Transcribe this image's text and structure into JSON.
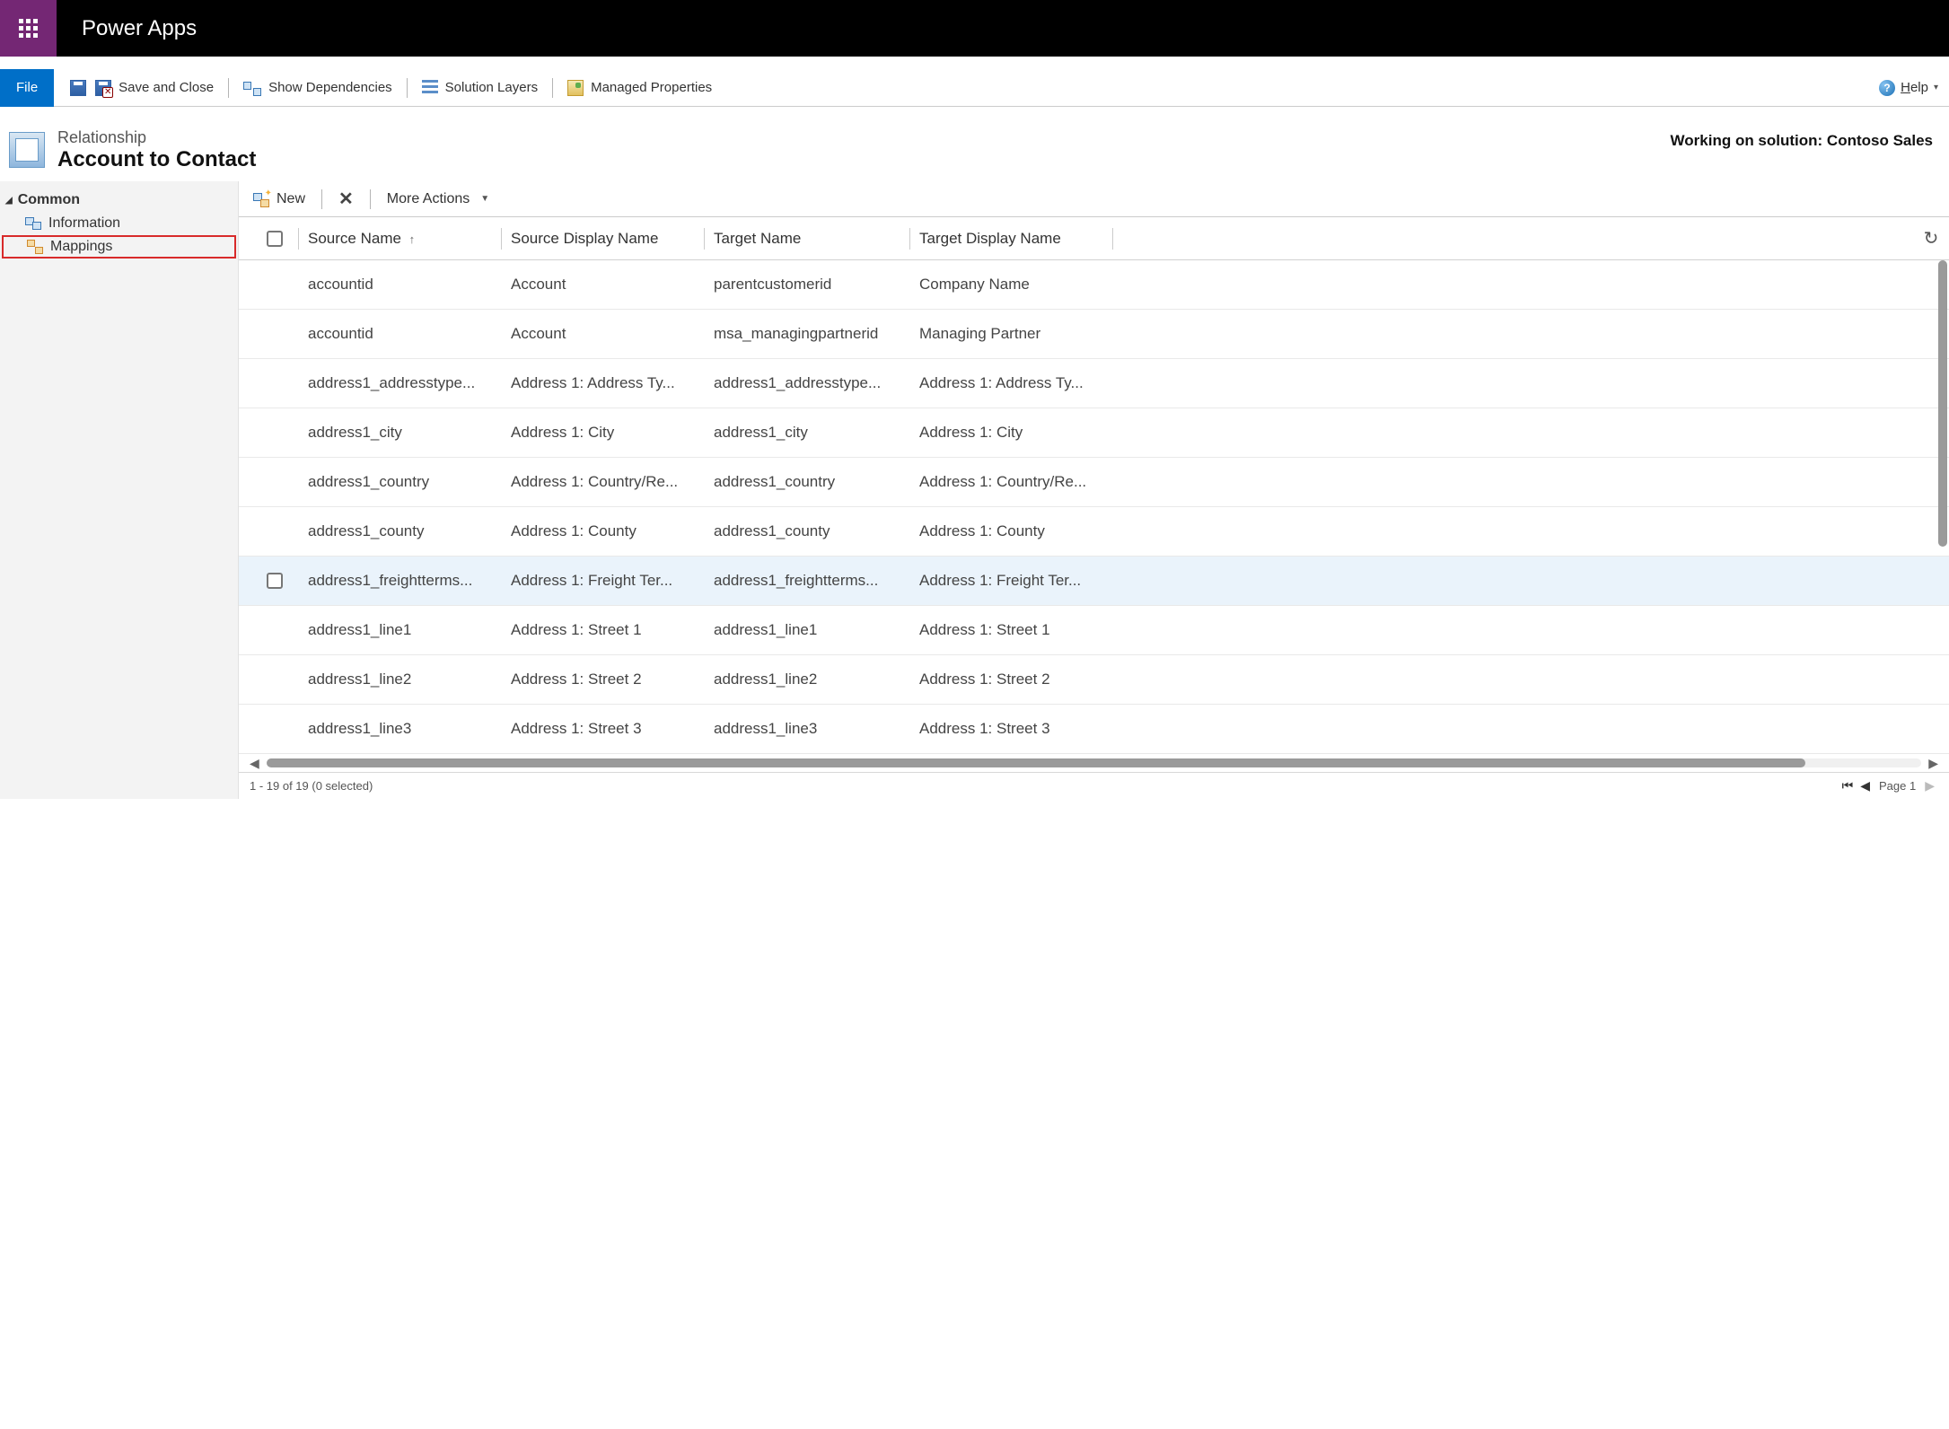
{
  "header": {
    "app_title": "Power Apps"
  },
  "ribbon": {
    "file": "File",
    "save_close": "Save and Close",
    "show_deps": "Show Dependencies",
    "solution_layers": "Solution Layers",
    "managed_props": "Managed Properties",
    "help": "Help"
  },
  "page": {
    "subtitle": "Relationship",
    "title": "Account to Contact",
    "working_on": "Working on solution: Contoso Sales"
  },
  "sidenav": {
    "group": "Common",
    "items": [
      {
        "label": "Information"
      },
      {
        "label": "Mappings"
      }
    ]
  },
  "listtoolbar": {
    "new": "New",
    "more": "More Actions"
  },
  "grid": {
    "columns": {
      "source_name": "Source Name",
      "source_display_name": "Source Display Name",
      "target_name": "Target Name",
      "target_display_name": "Target Display Name"
    },
    "sort_indicator": "↑",
    "rows": [
      {
        "sn": "accountid",
        "sdn": "Account",
        "tn": "parentcustomerid",
        "tdn": "Company Name"
      },
      {
        "sn": "accountid",
        "sdn": "Account",
        "tn": "msa_managingpartnerid",
        "tdn": "Managing Partner"
      },
      {
        "sn": "address1_addresstype...",
        "sdn": "Address 1: Address Ty...",
        "tn": "address1_addresstype...",
        "tdn": "Address 1: Address Ty..."
      },
      {
        "sn": "address1_city",
        "sdn": "Address 1: City",
        "tn": "address1_city",
        "tdn": "Address 1: City"
      },
      {
        "sn": "address1_country",
        "sdn": "Address 1: Country/Re...",
        "tn": "address1_country",
        "tdn": "Address 1: Country/Re..."
      },
      {
        "sn": "address1_county",
        "sdn": "Address 1: County",
        "tn": "address1_county",
        "tdn": "Address 1: County"
      },
      {
        "sn": "address1_freightterms...",
        "sdn": "Address 1: Freight Ter...",
        "tn": "address1_freightterms...",
        "tdn": "Address 1: Freight Ter..."
      },
      {
        "sn": "address1_line1",
        "sdn": "Address 1: Street 1",
        "tn": "address1_line1",
        "tdn": "Address 1: Street 1"
      },
      {
        "sn": "address1_line2",
        "sdn": "Address 1: Street 2",
        "tn": "address1_line2",
        "tdn": "Address 1: Street 2"
      },
      {
        "sn": "address1_line3",
        "sdn": "Address 1: Street 3",
        "tn": "address1_line3",
        "tdn": "Address 1: Street 3"
      }
    ]
  },
  "footer": {
    "record_status": "1 - 19 of 19 (0 selected)",
    "page_label": "Page 1"
  }
}
